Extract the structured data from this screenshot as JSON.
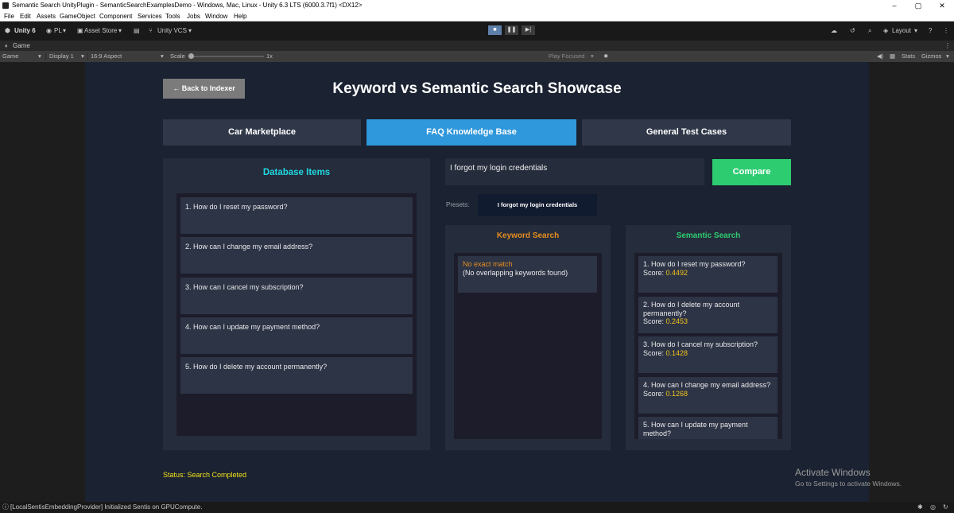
{
  "window": {
    "title": "Semantic Search UnityPlugin - SemanticSearchExamplesDemo - Windows, Mac, Linux - Unity 6.3 LTS (6000.3.7f1) <DX12>",
    "minimize": "–",
    "maximize": "▢",
    "close": "✕"
  },
  "menu": [
    "File",
    "Edit",
    "Assets",
    "GameObject",
    "Component",
    "Services",
    "Tools",
    "Jobs",
    "Window",
    "Help"
  ],
  "toolbar": {
    "unity_label": "Unity 6",
    "account_label": "PL",
    "asset_store_label": "Asset Store",
    "vcs_label": "Unity VCS",
    "layout_label": "Layout"
  },
  "game_tab": {
    "label": "Game"
  },
  "game_bar": {
    "mode": "Game",
    "display": "Display 1",
    "aspect": "16:9 Aspect",
    "scale_label": "Scale",
    "scale_value": "1x",
    "play_focused": "Play Focused",
    "stats": "Stats",
    "gizmos": "Gizmos"
  },
  "app": {
    "back_button": "← Back to Indexer",
    "title": "Keyword vs Semantic Search Showcase",
    "tabs": [
      {
        "label": "Car Marketplace",
        "active": false
      },
      {
        "label": "FAQ Knowledge Base",
        "active": true
      },
      {
        "label": "General Test Cases",
        "active": false
      }
    ],
    "database": {
      "heading": "Database Items",
      "items": [
        "1. How do I reset my password?",
        "2. How can I change my email address?",
        "3. How can I cancel my subscription?",
        "4. How can I update my payment method?",
        "5. How do I delete my account permanently?"
      ]
    },
    "search": {
      "query": "I forgot my login credentials",
      "compare_button": "Compare",
      "presets_label": "Presets:",
      "preset": "I forgot my login credentials"
    },
    "keyword": {
      "heading": "Keyword Search",
      "no_match": "No exact match",
      "no_match_detail": "(No overlapping keywords found)"
    },
    "semantic": {
      "heading": "Semantic Search",
      "score_label": "Score:",
      "results": [
        {
          "text": "1. How do I reset my password?",
          "score": "0.4492"
        },
        {
          "text": "2. How do I delete my account permanently?",
          "score": "0.2453"
        },
        {
          "text": "3. How do I cancel my subscription?",
          "score": "0.1428"
        },
        {
          "text": "4. How can I change my email address?",
          "score": "0.1268"
        },
        {
          "text": "5. How can I update my payment method?",
          "score": ""
        }
      ]
    },
    "status": "Status: Search Completed"
  },
  "watermark": {
    "title": "Activate Windows",
    "subtitle": "Go to Settings to activate Windows."
  },
  "console": {
    "message": "[LocalSentisEmbeddingProvider] Initialized Sentis on GPUCompute."
  },
  "colors": {
    "accent_blue": "#2f97db",
    "compare_green": "#2ecc71",
    "cyan_heading": "#1fd8e0",
    "orange_heading": "#e58d20",
    "green_heading": "#2ecc71",
    "score_yellow": "#f2c31b",
    "status_yellow": "#f2e21b"
  }
}
